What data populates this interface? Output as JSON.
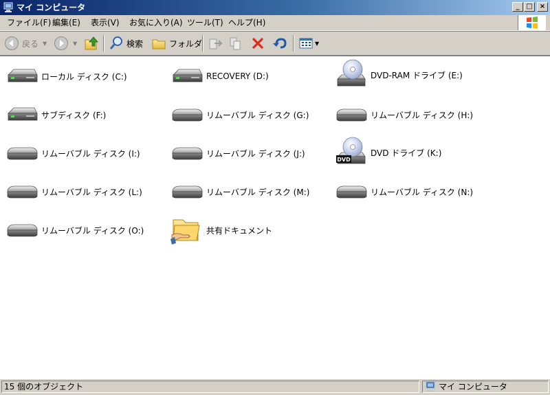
{
  "window": {
    "title": "マイ コンピュータ"
  },
  "menu": [
    "ファイル(F)",
    "編集(E)",
    "表示(V)",
    "お気に入り(A)",
    "ツール(T)",
    "ヘルプ(H)"
  ],
  "toolbar": {
    "back": "戻る",
    "search": "検索",
    "folders": "フォルダ"
  },
  "items": [
    {
      "label": "ローカル ディスク (C:)",
      "icon": "hard-drive-icon"
    },
    {
      "label": "RECOVERY (D:)",
      "icon": "hard-drive-icon"
    },
    {
      "label": "DVD-RAM ドライブ (E:)",
      "icon": "dvd-ram-drive-icon"
    },
    {
      "label": "サブディスク (F:)",
      "icon": "hard-drive-icon"
    },
    {
      "label": "リムーバブル ディスク (G:)",
      "icon": "removable-disk-icon"
    },
    {
      "label": "リムーバブル ディスク (H:)",
      "icon": "removable-disk-icon"
    },
    {
      "label": "リムーバブル ディスク (I:)",
      "icon": "removable-disk-icon"
    },
    {
      "label": "リムーバブル ディスク (J:)",
      "icon": "removable-disk-icon"
    },
    {
      "label": "DVD ドライブ (K:)",
      "icon": "dvd-drive-icon"
    },
    {
      "label": "リムーバブル ディスク (L:)",
      "icon": "removable-disk-icon"
    },
    {
      "label": "リムーバブル ディスク (M:)",
      "icon": "removable-disk-icon"
    },
    {
      "label": "リムーバブル ディスク (N:)",
      "icon": "removable-disk-icon"
    },
    {
      "label": "リムーバブル ディスク (O:)",
      "icon": "removable-disk-icon"
    },
    {
      "label": "共有ドキュメント",
      "icon": "shared-folder-icon"
    }
  ],
  "dvd_badge": "DVD",
  "status": {
    "count": "15 個のオブジェクト",
    "location": "マイ コンピュータ"
  }
}
